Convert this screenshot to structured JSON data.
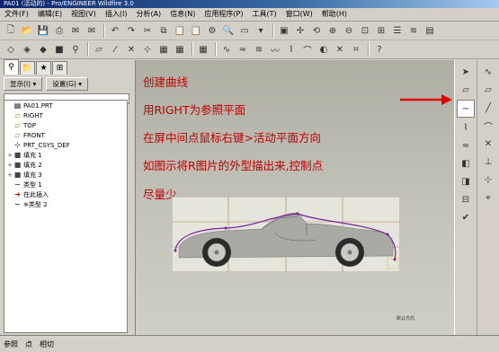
{
  "window": {
    "title": "PA01 (活动的) - Pro/ENGINEER Wildfire 3.0"
  },
  "menu": [
    "文件(F)",
    "编辑(E)",
    "视图(V)",
    "插入(I)",
    "分析(A)",
    "信息(N)",
    "应用程序(P)",
    "工具(T)",
    "窗口(W)",
    "帮助(H)"
  ],
  "nav": {
    "show_label": "显示(I) ▾",
    "settings_label": "设置(G) ▾",
    "tree": [
      {
        "label": "PA01.PRT",
        "icon": "part-icon",
        "expand": ""
      },
      {
        "label": "RIGHT",
        "icon": "datum-plane-icon",
        "expand": ""
      },
      {
        "label": "TOP",
        "icon": "datum-plane-icon",
        "expand": ""
      },
      {
        "label": "FRONT",
        "icon": "datum-plane-icon",
        "expand": ""
      },
      {
        "label": "PRT_CSYS_DEF",
        "icon": "csys-icon",
        "expand": ""
      },
      {
        "label": "填充 1",
        "icon": "fill-icon",
        "expand": "+"
      },
      {
        "label": "填充 2",
        "icon": "fill-icon",
        "expand": "+"
      },
      {
        "label": "填充 3",
        "icon": "fill-icon",
        "expand": "+"
      },
      {
        "label": "类型 1",
        "icon": "curve-icon",
        "expand": ""
      },
      {
        "label": "在此插入",
        "icon": "insert-here-icon",
        "expand": ""
      },
      {
        "label": "※类型 2",
        "icon": "curve-icon",
        "expand": ""
      }
    ]
  },
  "graphics": {
    "annotations": [
      "创建曲线",
      "用RIGHT为参照平面",
      "在屏中间点鼠标右键>活动平面方向",
      "如图示将R图片的外型描出来,控制点",
      "尽量少"
    ],
    "corner_label": "默认方向"
  },
  "status": {
    "tabs": [
      "参照",
      "点",
      "相切"
    ]
  },
  "colors": {
    "annotation": "#c00000",
    "arrow": "#e00000",
    "curve": "#7a1ea0"
  }
}
